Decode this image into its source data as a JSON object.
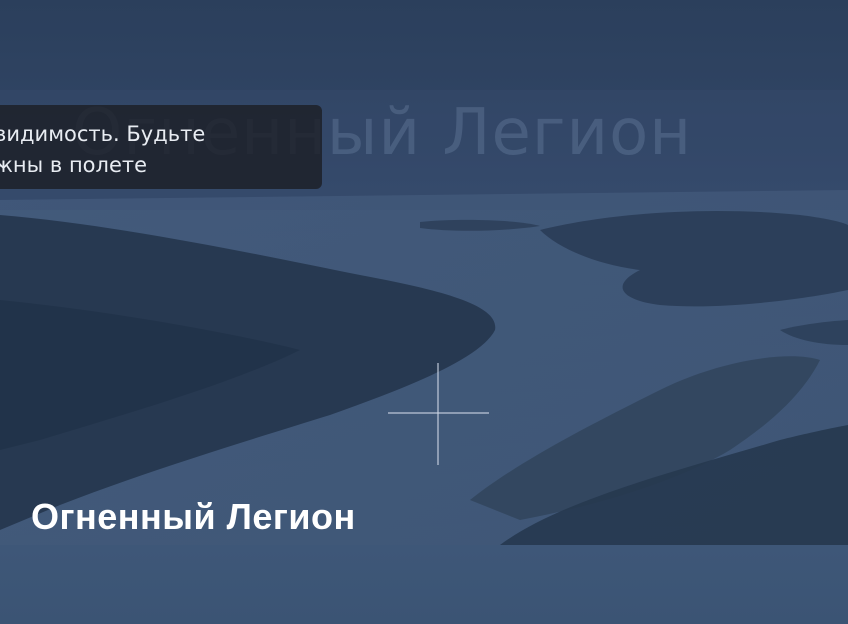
{
  "game": {
    "title": "Огненный Легион",
    "watermark": "Огненный Легион"
  },
  "notification": {
    "line1": "видимость. Будьте",
    "line2": "жны в полете"
  },
  "hud": {
    "crosshair_icon": "crosshair-icon"
  },
  "colors": {
    "sky": "#2f4564",
    "water": "#4a6385",
    "land": "#243650",
    "title_text": "#ffffff",
    "toast_bg": "#1c1f26"
  }
}
